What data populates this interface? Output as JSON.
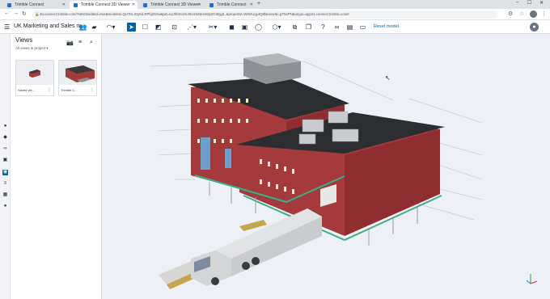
{
  "browser": {
    "tabs": [
      {
        "label": "Trimble Connect",
        "active": false
      },
      {
        "label": "Trimble Connect 3D Viewer",
        "active": true
      },
      {
        "label": "Trimble Connect 3D Viewer",
        "active": false
      },
      {
        "label": "Trimble Connect",
        "active": false
      }
    ],
    "new_tab": "+",
    "url": "3d.connect.trimble.com/?isEmbedded=true&modelId=QU7KLIOyKiLRPhjiOzIw&jwt=eyJhbGciOiJSUzI1NiIsImtpZCI6Ijg3..&projectId=W0GUqy4Q8f&viewId=g7NxPN&origin=app21.connect.trimble.com/t"
  },
  "app": {
    "project_name": "UK Marketing and Sales m...",
    "reset_label": "Reset model"
  },
  "views_panel": {
    "title": "Views",
    "subtitle": "All views in project",
    "thumbnails": [
      {
        "label": "Saved vie..."
      },
      {
        "label": "Trimble C..."
      }
    ]
  },
  "icons": {
    "hamburger": "menu-icon",
    "user": "user-avatar-icon",
    "axes": "axis-gizmo-icon"
  },
  "colors": {
    "accent": "#0063a3",
    "viewport_bg": "#edf0f6",
    "brick": "#a53a3c",
    "roof": "#2b2d30",
    "green_trim": "#3fae86"
  }
}
